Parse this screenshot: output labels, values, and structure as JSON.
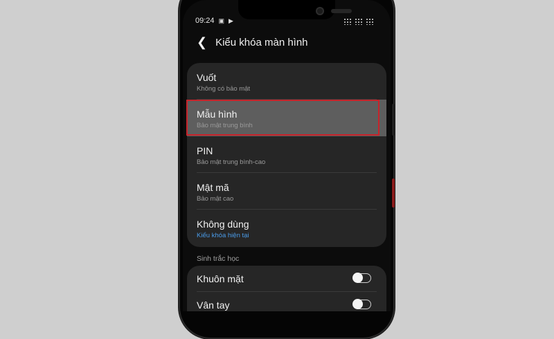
{
  "status": {
    "time": "09:24"
  },
  "header": {
    "title": "Kiểu khóa màn hình"
  },
  "options": [
    {
      "title": "Vuốt",
      "subtitle": "Không có bảo mật"
    },
    {
      "title": "Mẫu hình",
      "subtitle": "Bảo mật trung bình",
      "selected": true
    },
    {
      "title": "PIN",
      "subtitle": "Bảo mật trung bình-cao"
    },
    {
      "title": "Mật mã",
      "subtitle": "Bảo mật cao"
    },
    {
      "title": "Không dùng",
      "subtitle": "Kiểu khóa hiện tại",
      "current": true
    }
  ],
  "biometrics": {
    "section_title": "Sinh trắc học",
    "items": [
      {
        "label": "Khuôn mặt",
        "enabled": false
      },
      {
        "label": "Vân tay",
        "enabled": false
      }
    ]
  },
  "colors": {
    "highlight": "#c8232a",
    "current_link": "#4a9be8",
    "card_bg": "#262626"
  }
}
